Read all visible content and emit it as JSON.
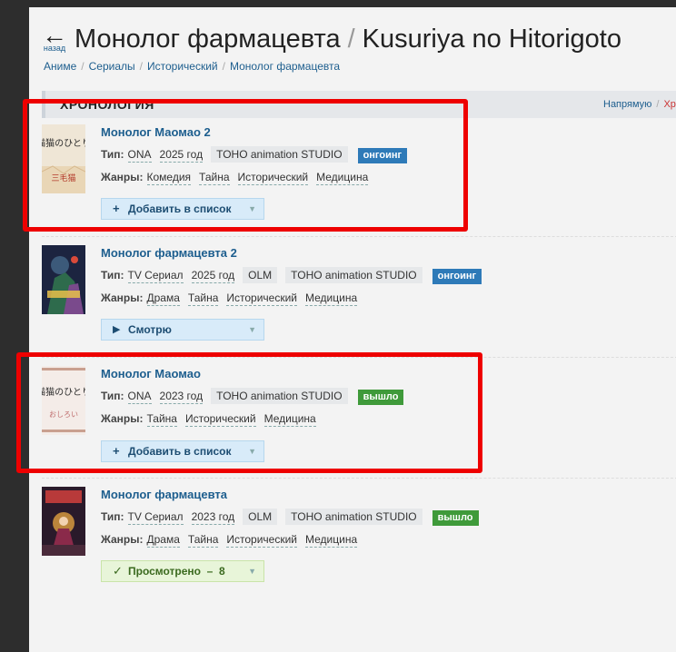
{
  "header": {
    "back_arrow": "←",
    "back_label": "назад",
    "title_ru": "Монолог фармацевта",
    "title_sep": "/",
    "title_romaji": "Kusuriya no Hitorigoto"
  },
  "breadcrumbs": [
    {
      "label": "Аниме"
    },
    {
      "label": "Сериалы"
    },
    {
      "label": "Исторический"
    },
    {
      "label": "Монолог фармацевта"
    }
  ],
  "crumb_sep": "/",
  "section": {
    "title": "ХРОНОЛОГИЯ",
    "link_direct": "Напрямую",
    "link_sep": "/",
    "link_partial": "Хр"
  },
  "labels": {
    "type": "Тип:",
    "genres": "Жанры:"
  },
  "entries": [
    {
      "name": "Монолог Маомао 2",
      "kind": "ONA",
      "year": "2025 год",
      "studios": [
        "TOHO animation STUDIO"
      ],
      "status": "онгоинг",
      "genres": [
        "Комедия",
        "Тайна",
        "Исторический",
        "Медицина"
      ],
      "button_icon": "+",
      "button_label": "Добавить в список",
      "button_arrow": "▼"
    },
    {
      "name": "Монолог фармацевта 2",
      "kind": "TV Сериал",
      "year": "2025 год",
      "studios": [
        "OLM",
        "TOHO animation STUDIO"
      ],
      "status": "онгоинг",
      "genres": [
        "Драма",
        "Тайна",
        "Исторический",
        "Медицина"
      ],
      "button_icon": "▶",
      "button_label": "Смотрю",
      "button_arrow": "▼"
    },
    {
      "name": "Монолог Маомао",
      "kind": "ONA",
      "year": "2023 год",
      "studios": [
        "TOHO animation STUDIO"
      ],
      "status": "вышло",
      "genres": [
        "Тайна",
        "Исторический",
        "Медицина"
      ],
      "button_icon": "+",
      "button_label": "Добавить в список",
      "button_arrow": "▼"
    },
    {
      "name": "Монолог фармацевта",
      "kind": "TV Сериал",
      "year": "2023 год",
      "studios": [
        "OLM",
        "TOHO animation STUDIO"
      ],
      "status": "вышло",
      "genres": [
        "Драма",
        "Тайна",
        "Исторический",
        "Медицина"
      ],
      "button_icon": "✓",
      "button_label": "Просмотрено  –  8",
      "button_arrow": "▼"
    }
  ],
  "poster_text": {
    "p1_title": "猫猫のひとり",
    "p1_sub": "三毛猫",
    "p3_title": "猫猫のひとり",
    "p3_sub": "おしろい"
  },
  "colors": {
    "link": "#1d5e8e",
    "ongoing": "#2e7ab8",
    "released": "#3f9a3a",
    "highlight": "#ee0000"
  }
}
